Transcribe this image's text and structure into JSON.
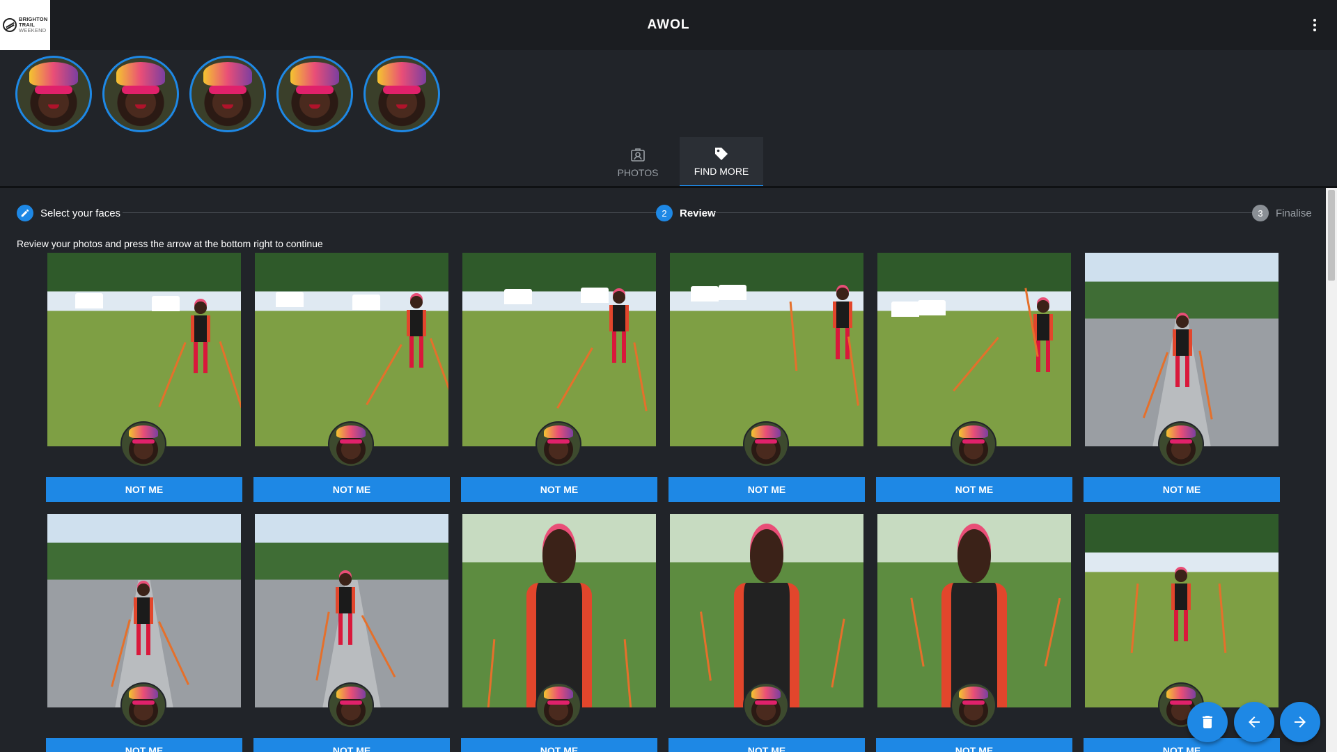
{
  "header": {
    "brand_lines": [
      "BRIGHTON",
      "TRAIL",
      "WEEKEND"
    ],
    "app_title": "AWOL"
  },
  "faces": [
    {
      "label": "selected-face-1"
    },
    {
      "label": "selected-face-2"
    },
    {
      "label": "selected-face-3"
    },
    {
      "label": "selected-face-4"
    },
    {
      "label": "selected-face-5"
    }
  ],
  "tabs": [
    {
      "label": "PHOTOS",
      "icon": "portrait-icon",
      "active": false
    },
    {
      "label": "FIND MORE",
      "icon": "tag-icon",
      "active": true
    }
  ],
  "stepper": {
    "steps": [
      {
        "num": "",
        "label": "Select your faces",
        "state": "done",
        "icon": "pencil-icon"
      },
      {
        "num": "2",
        "label": "Review",
        "state": "active"
      },
      {
        "num": "3",
        "label": "Finalise",
        "state": "pending"
      }
    ]
  },
  "instructions": "Review your photos and press the arrow at the bottom right to continue",
  "photos": [
    {
      "scene": "field",
      "button": "NOT ME"
    },
    {
      "scene": "field",
      "button": "NOT ME"
    },
    {
      "scene": "field",
      "button": "NOT ME"
    },
    {
      "scene": "field",
      "button": "NOT ME"
    },
    {
      "scene": "field",
      "button": "NOT ME"
    },
    {
      "scene": "road",
      "button": "NOT ME"
    },
    {
      "scene": "road",
      "button": "NOT ME"
    },
    {
      "scene": "road",
      "button": "NOT ME"
    },
    {
      "scene": "finish",
      "button": "NOT ME"
    },
    {
      "scene": "finish",
      "button": "NOT ME"
    },
    {
      "scene": "finish",
      "button": "NOT ME"
    },
    {
      "scene": "field",
      "button": "NOT ME"
    }
  ],
  "fabs": [
    {
      "name": "delete-button",
      "icon": "trash-icon"
    },
    {
      "name": "back-button",
      "icon": "arrow-left-icon"
    },
    {
      "name": "next-button",
      "icon": "arrow-right-icon"
    }
  ],
  "colors": {
    "accent": "#1e88e5",
    "background": "#212429",
    "header": "#1b1d21"
  }
}
